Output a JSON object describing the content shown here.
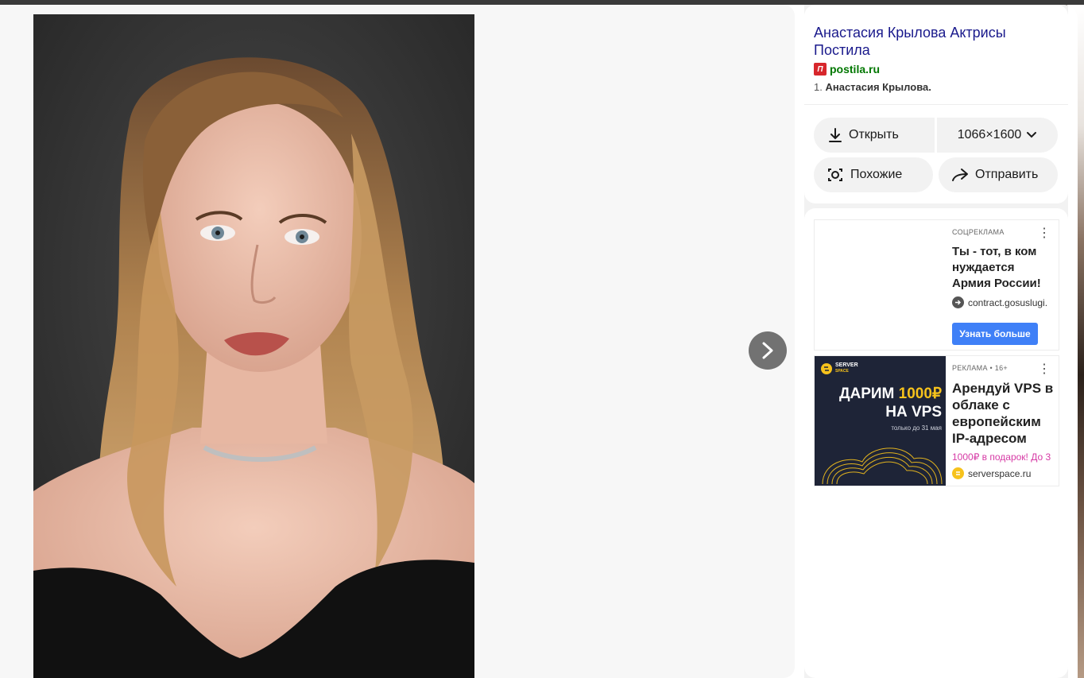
{
  "viewer": {
    "photo_alt": "portrait photo",
    "next_icon": "chevron-right-icon"
  },
  "info": {
    "title": "Анастасия Крылова Актрисы Постила",
    "source_icon_letter": "П",
    "source_domain": "postila.ru",
    "snippet_prefix": "1. ",
    "snippet_bold": "Анастасия Крылова."
  },
  "actions": {
    "open_label": "Открыть",
    "size_label": "1066×1600",
    "similar_label": "Похожие",
    "share_label": "Отправить"
  },
  "ads": [
    {
      "label": "СОЦРЕКЛАМА",
      "title": "Ты - тот, в ком нуждается Армия России!",
      "link": "contract.gosuslugi.",
      "cta": "Узнать больше"
    },
    {
      "label": "РЕКЛАМА • 16+",
      "title": "Арендуй VPS в облаке с европейским IP-адресом",
      "promo": "1000₽ в подарок! До 3",
      "link": "serverspace.ru",
      "image": {
        "brand_line1": "SERVER",
        "brand_line2": "SPACE",
        "headline_prefix": "ДАРИМ ",
        "headline_amount": "1000₽",
        "headline_line2": "НА VPS",
        "subline": "только до 31 мая"
      }
    }
  ],
  "colors": {
    "title_link": "#1a1a8c",
    "source_green": "#007700",
    "cta_blue": "#3f80f7",
    "promo_pink": "#d63aa5",
    "ad_accent_yellow": "#f6c21c"
  }
}
